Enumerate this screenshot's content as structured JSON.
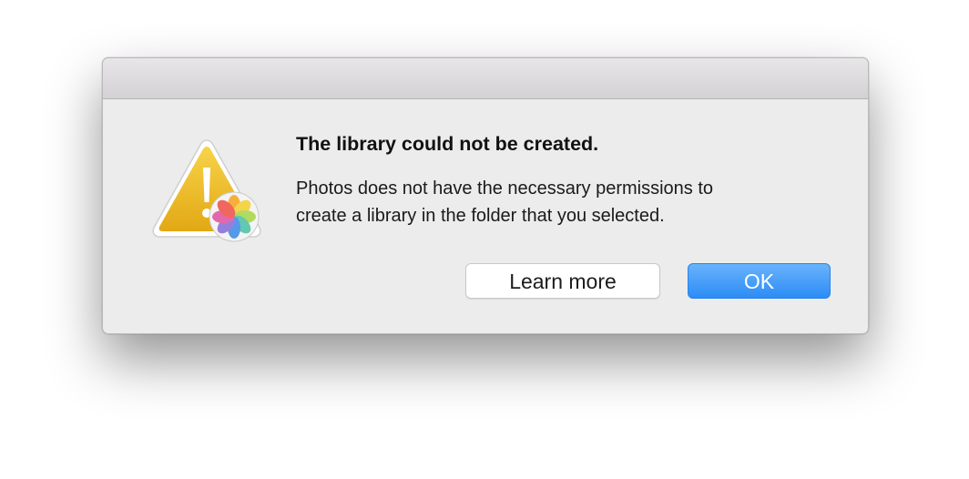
{
  "dialog": {
    "icon": "caution-triangle-icon",
    "badge_icon": "photos-app-icon",
    "title": "The library could not be created.",
    "message_line1": "Photos does not have the necessary permissions to",
    "message_line2": "create a library in the folder that you selected.",
    "buttons": {
      "learn_more": "Learn more",
      "ok": "OK"
    }
  },
  "colors": {
    "accent": "#2c8cf6",
    "warning": "#f0bd2c",
    "dialog_background": "#ececec"
  }
}
